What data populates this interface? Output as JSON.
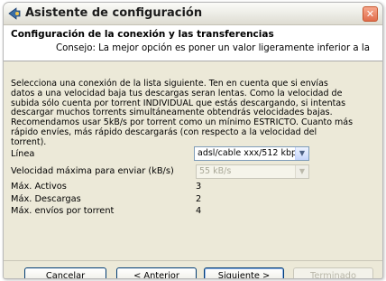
{
  "window": {
    "title": "Asistente de configuración",
    "close_glyph": "✕",
    "icon": "wizard-icon"
  },
  "header": {
    "title": "Configuración de la conexión y las transferencias",
    "tip": "Consejo: La mejor opción es poner un valor ligeramente inferior a la"
  },
  "description": [
    "Selecciona una conexión de la lista siguiente. Ten en cuenta que si envías",
    "datos a una velocidad baja tus descargas seran lentas. Como la velocidad de",
    "subida sólo cuenta por torrent INDIVIDUAL que estás descargando, si intentas",
    "descargar muchos torrents simultáneamente obtendrás velocidades bajas.",
    "Recomendamos usar 5kB/s por torrent como un mínimo ESTRICTO. Cuanto más",
    "rápido envíes, más rápido descargarás (con respecto a la velocidad del",
    "torrent)."
  ],
  "form": {
    "line_label": "Línea",
    "line_value": "adsl/cable xxx/512 kbps",
    "max_upload_label": "Velocidad máxima para enviar (kB/s)",
    "max_upload_value": "55 kB/s",
    "max_active_label": "Máx. Activos",
    "max_active_value": "3",
    "max_downloads_label": "Máx. Descargas",
    "max_downloads_value": "2",
    "max_uploads_label": "Máx. envíos por torrent",
    "max_uploads_value": "4"
  },
  "buttons": {
    "cancel": "Cancelar",
    "previous": "< Anterior",
    "next": "Siguiente >",
    "finish": "Terminado"
  },
  "dropdown_arrow": "▼"
}
